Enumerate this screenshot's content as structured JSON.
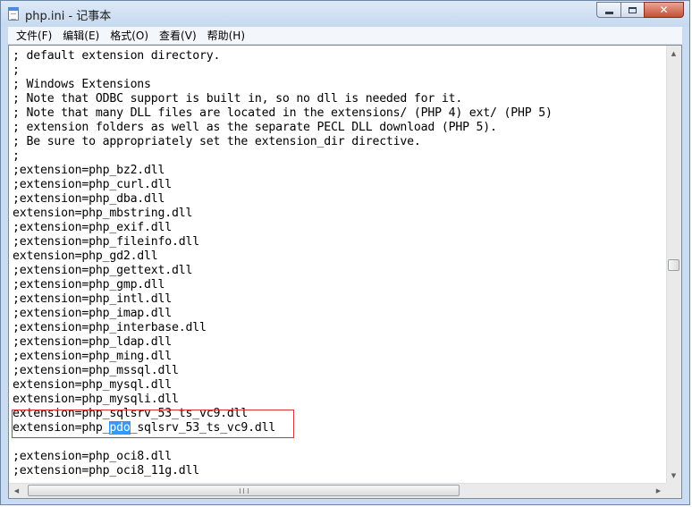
{
  "window": {
    "title": "php.ini - 记事本"
  },
  "menu": [
    {
      "label": "文件(F)"
    },
    {
      "label": "编辑(E)"
    },
    {
      "label": "格式(O)"
    },
    {
      "label": "查看(V)"
    },
    {
      "label": "帮助(H)"
    }
  ],
  "lines": [
    "; default extension directory.",
    ";",
    "; Windows Extensions",
    "; Note that ODBC support is built in, so no dll is needed for it.",
    "; Note that many DLL files are located in the extensions/ (PHP 4) ext/ (PHP 5)",
    "; extension folders as well as the separate PECL DLL download (PHP 5).",
    "; Be sure to appropriately set the extension_dir directive.",
    ";",
    ";extension=php_bz2.dll",
    ";extension=php_curl.dll",
    ";extension=php_dba.dll",
    "extension=php_mbstring.dll",
    ";extension=php_exif.dll",
    ";extension=php_fileinfo.dll",
    "extension=php_gd2.dll",
    ";extension=php_gettext.dll",
    ";extension=php_gmp.dll",
    ";extension=php_intl.dll",
    ";extension=php_imap.dll",
    ";extension=php_interbase.dll",
    ";extension=php_ldap.dll",
    ";extension=php_ming.dll",
    ";extension=php_mssql.dll",
    "extension=php_mysql.dll",
    "extension=php_mysqli.dll",
    "extension=php_sqlsrv_53_ts_vc9.dll",
    "",
    "",
    ";extension=php_oci8.dll",
    ";extension=php_oci8_11g.dll"
  ],
  "selection_line": {
    "before": "extension=php_",
    "selected": "pdo",
    "after": "_sqlsrv_53_ts_vc9.dll"
  },
  "icons": {
    "app": "notepad-icon",
    "minimize": "minimize-icon",
    "maximize": "maximize-icon",
    "close": "close-icon"
  }
}
